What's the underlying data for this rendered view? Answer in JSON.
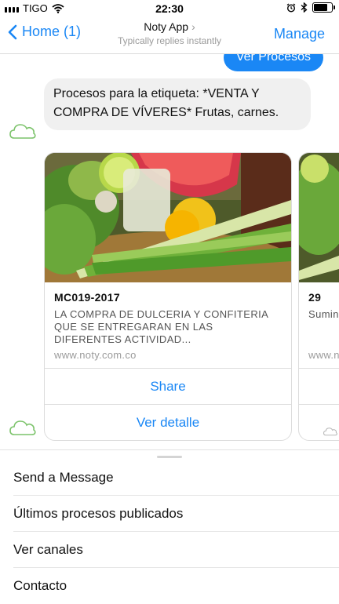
{
  "status_bar": {
    "carrier": "TIGO",
    "time": "22:30"
  },
  "nav": {
    "back_label": "Home (1)",
    "title": "Noty App",
    "subtitle": "Typically replies instantly",
    "manage_label": "Manage"
  },
  "chat": {
    "user_message": "Ver Procesos",
    "bot_message": "Procesos para la etiqueta: *VENTA Y COMPRA DE VÍVERES* Frutas, carnes.",
    "cards": [
      {
        "title": "MC019-2017",
        "description": "LA COMPRA DE DULCERIA Y CONFITERIA QUE SE ENTREGARAN EN LAS DIFERENTES ACTIVIDAD...",
        "url": "www.noty.com.co",
        "share_label": "Share",
        "detail_label": "Ver detalle"
      },
      {
        "title": "29",
        "description": "Sumini familia",
        "url": "www.n"
      }
    ]
  },
  "menu": {
    "items": [
      "Send a Message",
      "Últimos procesos publicados",
      "Ver canales",
      "Contacto"
    ]
  },
  "colors": {
    "accent": "#1a87f5",
    "bubble_gray": "#f0f0f0",
    "avatar_green": "#7cc36b"
  }
}
